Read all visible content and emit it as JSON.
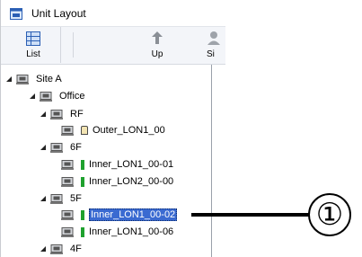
{
  "window": {
    "title": "Unit Layout"
  },
  "toolbar": {
    "list_label": "List",
    "up_label": "Up",
    "partial_label": "Si"
  },
  "tree": {
    "nodes": [
      {
        "label": "Site A",
        "icon": "network-icon"
      },
      {
        "label": "Office",
        "icon": "network-icon"
      },
      {
        "label": "RF",
        "icon": "network-icon"
      },
      {
        "label": "Outer_LON1_00",
        "icon": "outdoor-unit-icon"
      },
      {
        "label": "6F",
        "icon": "network-icon"
      },
      {
        "label": "Inner_LON1_00-01",
        "icon": "indoor-unit-icon"
      },
      {
        "label": "Inner_LON2_00-00",
        "icon": "indoor-unit-icon"
      },
      {
        "label": "5F",
        "icon": "network-icon"
      },
      {
        "label": "Inner_LON1_00-02",
        "icon": "indoor-unit-icon",
        "selected": true
      },
      {
        "label": "Inner_LON1_00-06",
        "icon": "indoor-unit-icon"
      },
      {
        "label": "4F",
        "icon": "network-icon"
      }
    ]
  },
  "callout": {
    "label": "①"
  },
  "colors": {
    "selection": "#3a6ad1",
    "indoor_unit": "#1fa12e",
    "outdoor_unit": "#f2e4b3"
  }
}
